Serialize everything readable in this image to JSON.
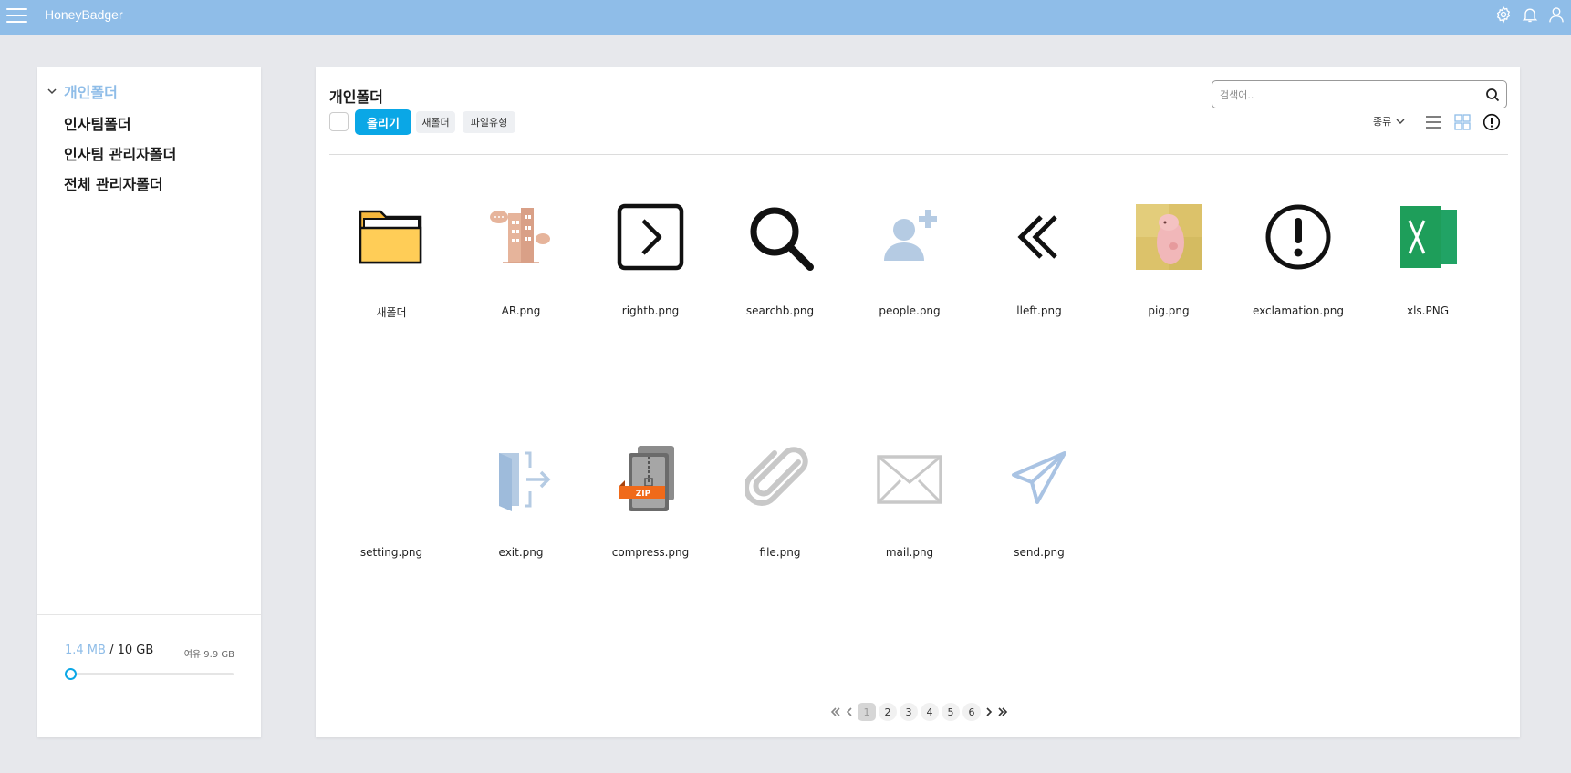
{
  "app": {
    "title": "HoneyBadger"
  },
  "topbar": {
    "icons": [
      "gear-icon",
      "bell-icon",
      "user-icon"
    ]
  },
  "sidebar": {
    "root": {
      "label": "개인폴더",
      "expanded": true
    },
    "children": [
      {
        "label": "인사팀폴더"
      },
      {
        "label": "인사팀 관리자폴더"
      },
      {
        "label": "전체 관리자폴더"
      }
    ],
    "storage": {
      "used": "1.4 MB",
      "separator": " / ",
      "total": "10 GB",
      "free": "여유 9.9 GB",
      "used_fraction": 0.0001
    }
  },
  "main": {
    "title": "개인폴더",
    "toolbar": {
      "upload": "올리기",
      "new_folder": "새폴더",
      "file_type": "파일유형"
    },
    "search": {
      "placeholder": "검색어.."
    },
    "sort": {
      "label": "종류"
    },
    "view_mode": "grid",
    "files": [
      {
        "name": "새폴더",
        "icon": "folder-icon"
      },
      {
        "name": "AR.png",
        "icon": "building-image"
      },
      {
        "name": "rightb.png",
        "icon": "chevron-right-box-icon"
      },
      {
        "name": "searchb.png",
        "icon": "search-icon"
      },
      {
        "name": "people.png",
        "icon": "add-person-icon"
      },
      {
        "name": "lleft.png",
        "icon": "double-chevron-left-icon"
      },
      {
        "name": "pig.png",
        "icon": "pig-image"
      },
      {
        "name": "exclamation.png",
        "icon": "exclamation-circle-icon"
      },
      {
        "name": "xls.PNG",
        "icon": "excel-icon"
      },
      {
        "name": "setting.png",
        "icon": "blank-image"
      },
      {
        "name": "exit.png",
        "icon": "exit-door-icon"
      },
      {
        "name": "compress.png",
        "icon": "zip-archive-icon"
      },
      {
        "name": "file.png",
        "icon": "paperclip-icon"
      },
      {
        "name": "mail.png",
        "icon": "envelope-icon"
      },
      {
        "name": "send.png",
        "icon": "paper-plane-icon"
      }
    ]
  },
  "pagination": {
    "pages": [
      "1",
      "2",
      "3",
      "4",
      "5",
      "6"
    ],
    "current": "1"
  }
}
